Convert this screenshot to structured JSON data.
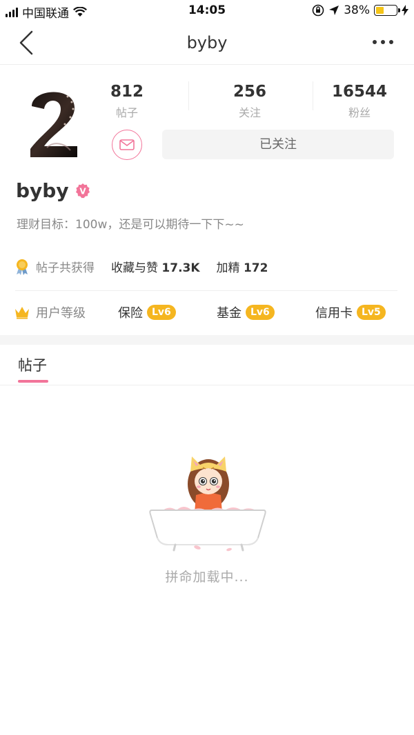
{
  "status_bar": {
    "carrier": "中国联通",
    "time": "14:05",
    "battery_percent": "38%",
    "battery_level": 0.38
  },
  "nav": {
    "title": "byby"
  },
  "profile": {
    "stats": [
      {
        "value": "812",
        "label": "帖子"
      },
      {
        "value": "256",
        "label": "关注"
      },
      {
        "value": "16544",
        "label": "粉丝"
      }
    ],
    "follow_button": "已关注",
    "username": "byby",
    "verified_badge": "V",
    "bio": "理财目标：100w，还是可以期待一下下~~",
    "awards": {
      "label": "帖子共获得",
      "likes_label": "收藏与赞",
      "likes_value": "17.3K",
      "featured_label": "加精",
      "featured_value": "172"
    },
    "levels": {
      "label": "用户等级",
      "items": [
        {
          "name": "保险",
          "level": "Lv6"
        },
        {
          "name": "基金",
          "level": "Lv6"
        },
        {
          "name": "信用卡",
          "level": "Lv5"
        }
      ]
    }
  },
  "tabs": [
    {
      "label": "帖子",
      "active": true
    }
  ],
  "loading": {
    "text": "拼命加载中..."
  },
  "colors": {
    "accent_pink": "#f27499",
    "level_badge": "#f5b620",
    "battery_fill": "#f5c518"
  }
}
